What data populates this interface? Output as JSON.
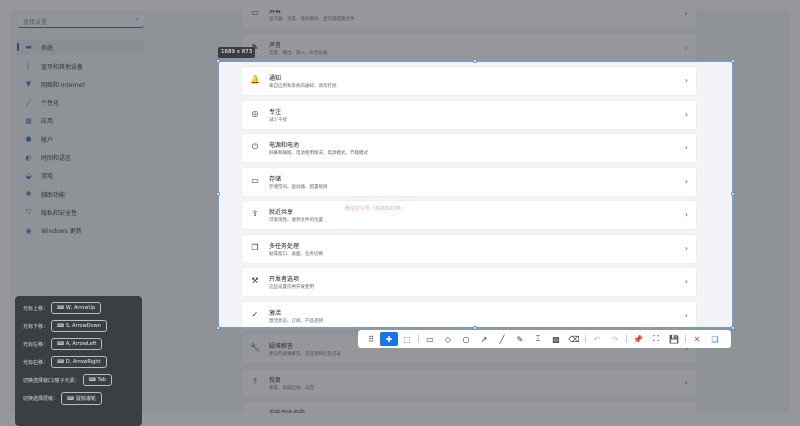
{
  "sidebar": {
    "search_placeholder": "查找设置",
    "items": [
      {
        "icon": "monitor-icon",
        "glyph": "▬",
        "label": "系统"
      },
      {
        "icon": "bluetooth-icon",
        "glyph": "ᛒ",
        "label": "蓝牙和其他设备"
      },
      {
        "icon": "wifi-icon",
        "glyph": "▼",
        "label": "网络和 Internet"
      },
      {
        "icon": "brush-icon",
        "glyph": "╱",
        "label": "个性化"
      },
      {
        "icon": "apps-icon",
        "glyph": "▦",
        "label": "应用"
      },
      {
        "icon": "account-icon",
        "glyph": "●",
        "label": "帐户"
      },
      {
        "icon": "globe-icon",
        "glyph": "◐",
        "label": "时间和语言"
      },
      {
        "icon": "gamepad-icon",
        "glyph": "◒",
        "label": "游戏"
      },
      {
        "icon": "accessibility-icon",
        "glyph": "✱",
        "label": "辅助功能"
      },
      {
        "icon": "shield-icon",
        "glyph": "⛉",
        "label": "隐私和安全性"
      },
      {
        "icon": "update-icon",
        "glyph": "◉",
        "label": "Windows 更新"
      }
    ]
  },
  "cards": [
    {
      "icon": "display-icon",
      "glyph": "▭",
      "title": "屏幕",
      "sub": "显示器、亮度、夜间模式、显示器配置文件"
    },
    {
      "icon": "sound-icon",
      "glyph": "🔈",
      "title": "声音",
      "sub": "音量、输出、输入、声音设备"
    },
    {
      "icon": "bell-icon",
      "glyph": "🔔",
      "title": "通知",
      "sub": "来自应用和系统的通知、请勿打扰"
    },
    {
      "icon": "focus-icon",
      "glyph": "◎",
      "title": "专注",
      "sub": "减少干扰"
    },
    {
      "icon": "power-icon",
      "glyph": "⏻",
      "title": "电源和电池",
      "sub": "屏幕和睡眠、电池使用情况、电源模式、节能模式"
    },
    {
      "icon": "storage-icon",
      "glyph": "▭",
      "title": "存储",
      "sub": "存储空间、驱动器、配置规则"
    },
    {
      "icon": "share-icon",
      "glyph": "⇪",
      "title": "就近共享",
      "sub": "可发现性、收到文件的位置"
    },
    {
      "icon": "multitask-icon",
      "glyph": "❐",
      "title": "多任务处理",
      "sub": "贴靠窗口、桌面、任务切换"
    },
    {
      "icon": "developer-icon",
      "glyph": "⚒",
      "title": "开发者选项",
      "sub": "这些设置仅供开发使用"
    },
    {
      "icon": "check-circle-icon",
      "glyph": "✓",
      "title": "激活",
      "sub": "激活状态、订阅、产品密钥"
    },
    {
      "icon": "wrench-icon",
      "glyph": "🔧",
      "title": "疑难解答",
      "sub": "建议的疑难解答、首选项和历史记录"
    },
    {
      "icon": "recovery-icon",
      "glyph": "⤒",
      "title": "恢复",
      "sub": "重置、高级启动、返回"
    },
    {
      "icon": "project-icon",
      "glyph": "▭",
      "title": "投影到此电脑",
      "sub": ""
    }
  ],
  "capture": {
    "size_label": "1689 x 873",
    "watermark": "微信公众号「科技BOOM」"
  },
  "shortcuts": [
    {
      "label": "光标上移：",
      "key": "W, ArrowUp"
    },
    {
      "label": "光标下移：",
      "key": "S, ArrowDown"
    },
    {
      "label": "光标左移：",
      "key": "A, ArrowLeft"
    },
    {
      "label": "光标右移：",
      "key": "D, ArrowRight"
    },
    {
      "label": "切换选择窗口/窗子元素：",
      "key": "Tab"
    },
    {
      "label": "切换选择层级：",
      "key": "鼠标滚轮"
    }
  ],
  "toolbar": [
    {
      "name": "drag-handle-icon",
      "g": "⠿"
    },
    {
      "name": "move-icon",
      "g": "✚",
      "act": true
    },
    {
      "name": "select-region-icon",
      "g": "⬚"
    },
    {
      "sep": true
    },
    {
      "name": "rectangle-icon",
      "g": "▭"
    },
    {
      "name": "diamond-icon",
      "g": "◇"
    },
    {
      "name": "circle-icon",
      "g": "○"
    },
    {
      "name": "arrow-icon",
      "g": "↗"
    },
    {
      "name": "line-icon",
      "g": "╱"
    },
    {
      "name": "pencil-icon",
      "g": "✎"
    },
    {
      "name": "text-icon",
      "g": "⌶"
    },
    {
      "name": "mosaic-icon",
      "g": "▩"
    },
    {
      "name": "eraser-icon",
      "g": "⌫"
    },
    {
      "sep": true
    },
    {
      "name": "undo-icon",
      "g": "↶"
    },
    {
      "name": "redo-icon",
      "g": "↷"
    },
    {
      "sep": true
    },
    {
      "name": "pin-icon",
      "g": "📌"
    },
    {
      "name": "ocr-icon",
      "g": "⛶"
    },
    {
      "name": "save-icon",
      "g": "💾"
    },
    {
      "sep": true
    },
    {
      "name": "close-icon",
      "g": "✕",
      "c": "#e53935"
    },
    {
      "name": "copy-icon",
      "g": "❏",
      "c": "#1a73e8"
    }
  ]
}
